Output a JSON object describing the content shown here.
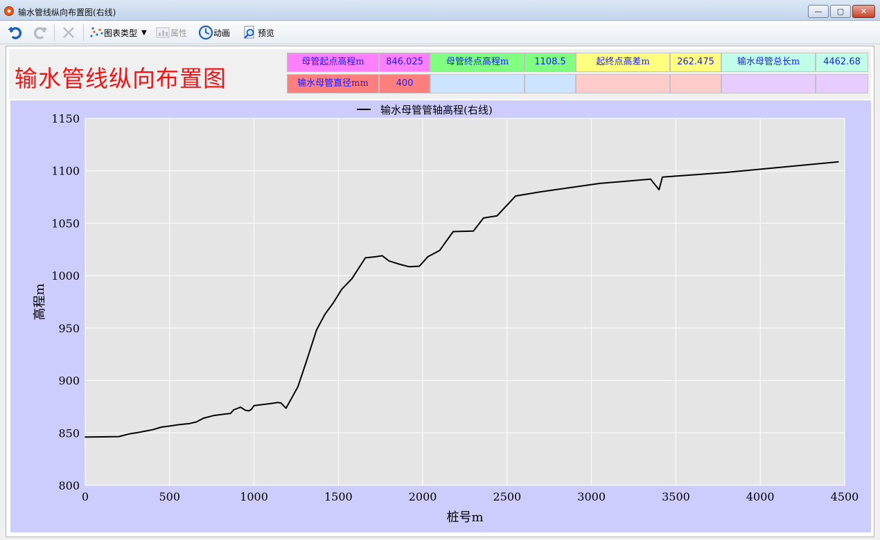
{
  "window": {
    "title": "输水管线纵向布置图(右线)",
    "controls": {
      "minimize": "—",
      "maximize": "▢",
      "close": "✕"
    }
  },
  "toolbar": {
    "undo_icon": "undo-icon",
    "redo_icon": "redo-icon",
    "delete_icon": "delete-icon",
    "chart_type_label": "图表类型",
    "properties_label": "属性",
    "animation_label": "动画",
    "preview_label": "预览"
  },
  "header": {
    "title": "输水管线纵向布置图",
    "row1": [
      {
        "label": "母管起点高程m",
        "value": "846.025"
      },
      {
        "label": "母管终点高程m",
        "value": "1108.5"
      },
      {
        "label": "起终点高差m",
        "value": "262.475"
      },
      {
        "label": "输水母管总长m",
        "value": "4462.68"
      }
    ],
    "row2": [
      {
        "label": "输水母管直径mm",
        "value": "400"
      },
      {
        "label": "",
        "value": ""
      },
      {
        "label": "",
        "value": ""
      },
      {
        "label": "",
        "value": ""
      }
    ],
    "colors": {
      "title": "#f01414",
      "cell_text_blue": "#1a1aff",
      "magenta_bg": "#ff80ff",
      "green_bg": "#80ff80",
      "yellow_bg": "#ffff80",
      "cyan_bg": "#c0ffe8",
      "salmon_bg": "#ff7f7f",
      "light_blue_bg": "#cce4ff",
      "pink_bg": "#ffcccc",
      "lavender_bg": "#e6ccff"
    }
  },
  "chart_data": {
    "type": "line",
    "title": "",
    "xlabel": "桩号m",
    "ylabel": "高程m",
    "xlim": [
      0,
      4500
    ],
    "ylim": [
      800,
      1150
    ],
    "x_ticks": [
      "0",
      "500",
      "1000",
      "1500",
      "2000",
      "2500",
      "3000",
      "3500",
      "4000",
      "4500"
    ],
    "y_ticks": [
      "800",
      "850",
      "900",
      "950",
      "1000",
      "1050",
      "1100",
      "1150"
    ],
    "grid": true,
    "legend_placement": "top-center",
    "series": [
      {
        "name": "输水母管管轴高程(右线)",
        "color": "#000000",
        "points": [
          [
            0,
            846
          ],
          [
            100,
            846.2
          ],
          [
            200,
            846.5
          ],
          [
            260,
            849
          ],
          [
            300,
            850
          ],
          [
            350,
            851.5
          ],
          [
            400,
            853
          ],
          [
            450,
            855.5
          ],
          [
            500,
            856.5
          ],
          [
            560,
            858
          ],
          [
            620,
            859
          ],
          [
            660,
            860.5
          ],
          [
            700,
            864
          ],
          [
            760,
            866.5
          ],
          [
            830,
            868
          ],
          [
            860,
            868.5
          ],
          [
            880,
            872
          ],
          [
            920,
            874.5
          ],
          [
            950,
            871.5
          ],
          [
            970,
            871
          ],
          [
            985,
            872.5
          ],
          [
            1000,
            876
          ],
          [
            1050,
            877
          ],
          [
            1100,
            878
          ],
          [
            1140,
            879
          ],
          [
            1160,
            878.5
          ],
          [
            1190,
            873.5
          ],
          [
            1260,
            894
          ],
          [
            1310,
            918
          ],
          [
            1370,
            948
          ],
          [
            1420,
            963
          ],
          [
            1470,
            974
          ],
          [
            1520,
            987
          ],
          [
            1580,
            997
          ],
          [
            1660,
            1017
          ],
          [
            1720,
            1018
          ],
          [
            1760,
            1019
          ],
          [
            1800,
            1014
          ],
          [
            1860,
            1011
          ],
          [
            1920,
            1008.5
          ],
          [
            1980,
            1009
          ],
          [
            2030,
            1018
          ],
          [
            2100,
            1024
          ],
          [
            2180,
            1042
          ],
          [
            2300,
            1042.5
          ],
          [
            2360,
            1055
          ],
          [
            2440,
            1057
          ],
          [
            2550,
            1076
          ],
          [
            2700,
            1080
          ],
          [
            3050,
            1088
          ],
          [
            3350,
            1092
          ],
          [
            3400,
            1082
          ],
          [
            3420,
            1094
          ],
          [
            3800,
            1098.5
          ],
          [
            4462.68,
            1108.5
          ]
        ]
      }
    ]
  }
}
